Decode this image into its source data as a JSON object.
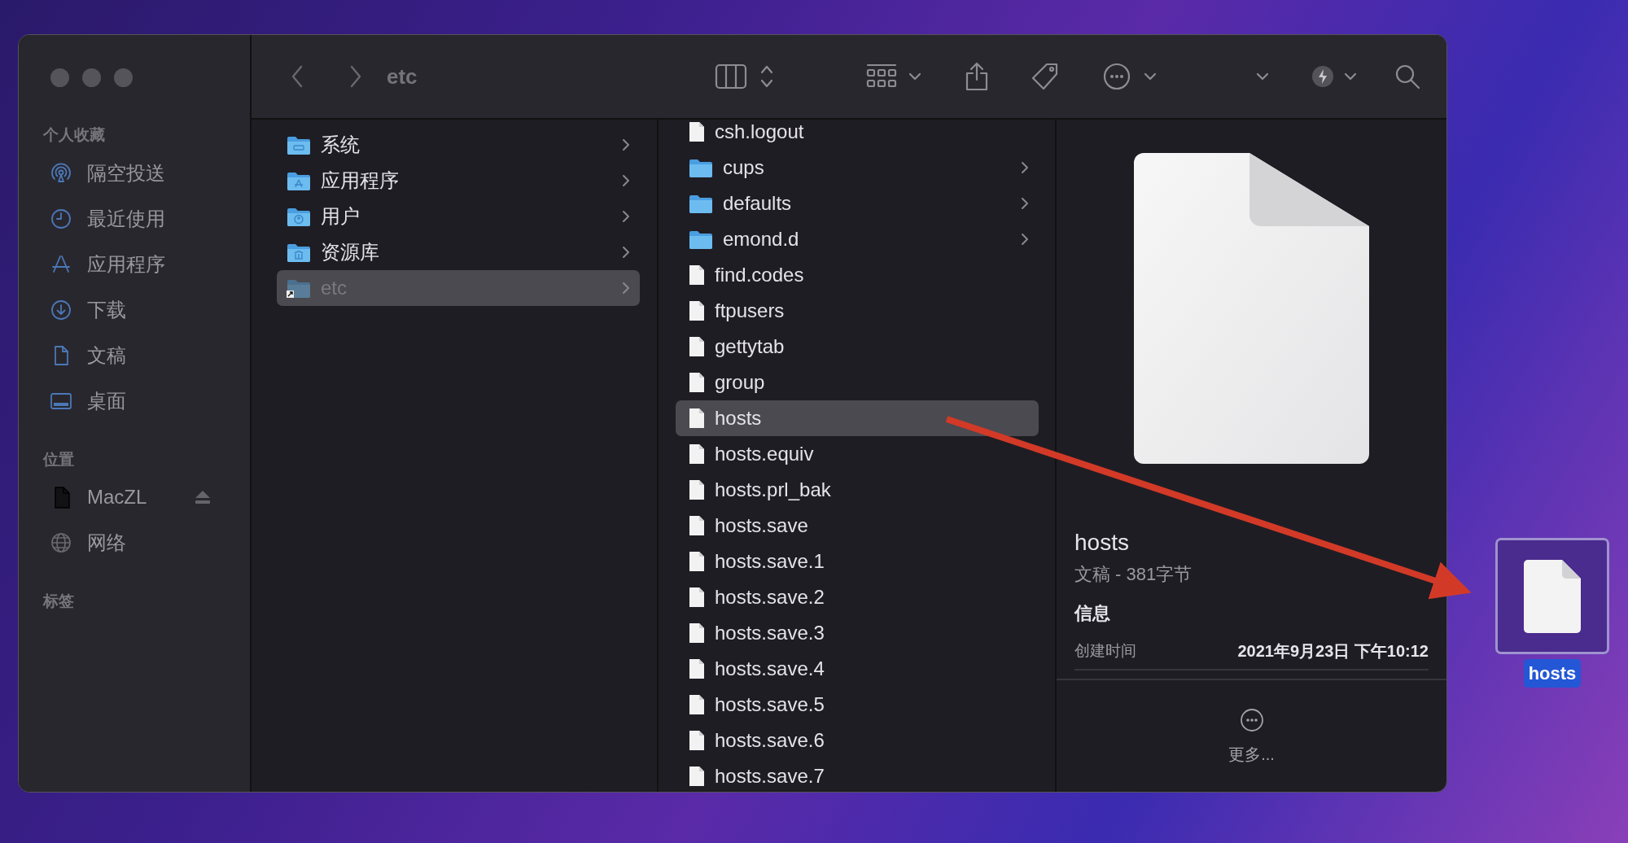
{
  "toolbar": {
    "title": "etc"
  },
  "sidebar": {
    "sections": [
      {
        "title": "个人收藏",
        "items": [
          {
            "label": "隔空投送",
            "kind": "airdrop"
          },
          {
            "label": "最近使用",
            "kind": "recents"
          },
          {
            "label": "应用程序",
            "kind": "apps"
          },
          {
            "label": "下载",
            "kind": "downloads"
          },
          {
            "label": "文稿",
            "kind": "documents"
          },
          {
            "label": "桌面",
            "kind": "desktop"
          }
        ]
      },
      {
        "title": "位置",
        "items": [
          {
            "label": "MacZL",
            "kind": "disk",
            "ejectable": true
          },
          {
            "label": "网络",
            "kind": "network",
            "ejectable": false
          }
        ]
      },
      {
        "title": "标签"
      }
    ]
  },
  "columns": [
    {
      "items": [
        {
          "name": "系统",
          "kind": "system-folder",
          "selected": false
        },
        {
          "name": "应用程序",
          "kind": "apps-folder",
          "selected": false
        },
        {
          "name": "用户",
          "kind": "users-folder",
          "selected": false
        },
        {
          "name": "资源库",
          "kind": "library-folder",
          "selected": false
        },
        {
          "name": "etc",
          "kind": "alias-folder",
          "selected": true
        }
      ]
    },
    {
      "items": [
        {
          "name": "csh.logout",
          "kind": "file",
          "selected": false
        },
        {
          "name": "cups",
          "kind": "folder",
          "selected": false
        },
        {
          "name": "defaults",
          "kind": "folder",
          "selected": false
        },
        {
          "name": "emond.d",
          "kind": "folder",
          "selected": false
        },
        {
          "name": "find.codes",
          "kind": "file",
          "selected": false
        },
        {
          "name": "ftpusers",
          "kind": "file",
          "selected": false
        },
        {
          "name": "gettytab",
          "kind": "file",
          "selected": false
        },
        {
          "name": "group",
          "kind": "file",
          "selected": false
        },
        {
          "name": "hosts",
          "kind": "file",
          "selected": true
        },
        {
          "name": "hosts.equiv",
          "kind": "file",
          "selected": false
        },
        {
          "name": "hosts.prl_bak",
          "kind": "file",
          "selected": false
        },
        {
          "name": "hosts.save",
          "kind": "file",
          "selected": false
        },
        {
          "name": "hosts.save.1",
          "kind": "file",
          "selected": false
        },
        {
          "name": "hosts.save.2",
          "kind": "file",
          "selected": false
        },
        {
          "name": "hosts.save.3",
          "kind": "file",
          "selected": false
        },
        {
          "name": "hosts.save.4",
          "kind": "file",
          "selected": false
        },
        {
          "name": "hosts.save.5",
          "kind": "file",
          "selected": false
        },
        {
          "name": "hosts.save.6",
          "kind": "file",
          "selected": false
        },
        {
          "name": "hosts.save.7",
          "kind": "file",
          "selected": false
        }
      ]
    }
  ],
  "preview": {
    "name": "hosts",
    "subtitle": "文稿 - 381字节",
    "section_title": "信息",
    "info_rows": [
      {
        "label": "创建时间",
        "value": "2021年9月23日 下午10:12"
      }
    ],
    "more_label": "更多..."
  },
  "desktop_icon": {
    "label": "hosts",
    "selected": true
  }
}
